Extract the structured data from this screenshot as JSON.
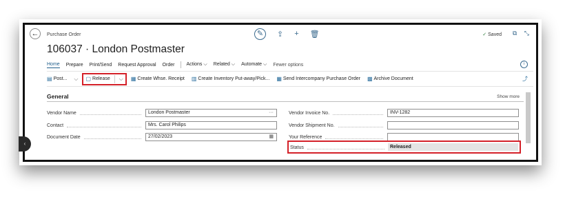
{
  "header": {
    "breadcrumb": "Purchase Order",
    "title": "106037 · London Postmaster",
    "saved_label": "Saved"
  },
  "icons": {
    "back": "arrow-left-icon",
    "edit": "pencil-icon",
    "share": "share-icon",
    "new": "plus-icon",
    "delete": "trash-icon",
    "open_new_window": "open-new-window-icon",
    "collapse": "collapse-icon",
    "info": "info-icon",
    "pin": "pin-icon"
  },
  "menu": {
    "home": "Home",
    "prepare": "Prepare",
    "print_send": "Print/Send",
    "request_approval": "Request Approval",
    "order": "Order",
    "actions": "Actions",
    "related": "Related",
    "automate": "Automate",
    "fewer_options": "Fewer options"
  },
  "toolbar": {
    "post": "Post...",
    "release": "Release",
    "create_whse_receipt": "Create Whse. Receipt",
    "create_inventory_putaway": "Create Inventory Put-away/Pick...",
    "send_intercompany": "Send Intercompany Purchase Order",
    "archive_document": "Archive Document"
  },
  "general": {
    "title": "General",
    "show_more": "Show more",
    "vendor_name_label": "Vendor Name",
    "vendor_name_value": "London Postmaster",
    "contact_label": "Contact",
    "contact_value": "Mrs. Carol Philips",
    "document_date_label": "Document Date",
    "document_date_value": "27/02/2023",
    "vendor_invoice_no_label": "Vendor Invoice No.",
    "vendor_invoice_no_value": "INV-1282",
    "vendor_shipment_no_label": "Vendor Shipment No.",
    "vendor_shipment_no_value": "",
    "your_reference_label": "Your Reference",
    "your_reference_value": "",
    "status_label": "Status",
    "status_value": "Released"
  },
  "colors": {
    "highlight_red": "#d42028",
    "accent_blue": "#1d5c8a"
  }
}
